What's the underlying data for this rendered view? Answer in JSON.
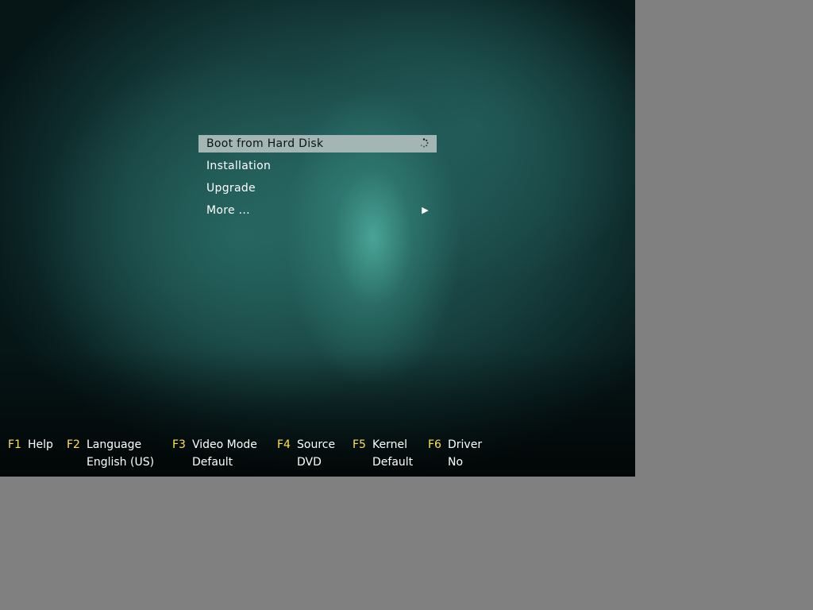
{
  "menu": {
    "items": [
      {
        "label": "Boot from Hard Disk",
        "selected": true
      },
      {
        "label": "Installation"
      },
      {
        "label": "Upgrade"
      },
      {
        "label": "More ...",
        "submenu_arrow": "▶"
      }
    ]
  },
  "function_keys": [
    {
      "key": "F1",
      "label": "Help",
      "value": ""
    },
    {
      "key": "F2",
      "label": "Language",
      "value": "English (US)"
    },
    {
      "key": "F3",
      "label": "Video Mode",
      "value": "Default"
    },
    {
      "key": "F4",
      "label": "Source",
      "value": "DVD"
    },
    {
      "key": "F5",
      "label": "Kernel",
      "value": "Default"
    },
    {
      "key": "F6",
      "label": "Driver",
      "value": "No"
    }
  ],
  "colors": {
    "key_accent": "#ffe14d",
    "selection_bar": "#a3b6b4",
    "text": "#ffffff",
    "outside_background": "#808080"
  },
  "icons": {
    "busy": "spinner-icon",
    "more": "submenu-arrow-icon"
  }
}
